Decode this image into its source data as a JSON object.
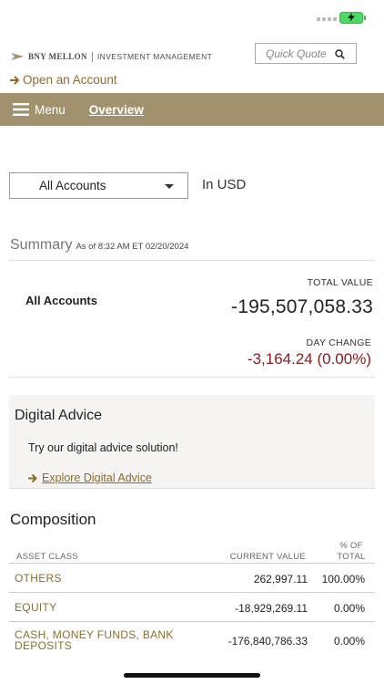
{
  "header": {
    "brand_name": "BNY MELLON",
    "brand_sub": "INVESTMENT MANAGEMENT",
    "quick_quote_placeholder": "Quick Quote",
    "open_account_label": "Open an Account"
  },
  "nav": {
    "menu_label": "Menu",
    "overview_label": "Overview"
  },
  "accounts": {
    "selected": "All Accounts",
    "currency_label": "In USD"
  },
  "summary": {
    "title": "Summary",
    "as_of": "As of 8:32 AM ET 02/20/2024",
    "account_name": "All Accounts",
    "total_value_label": "TOTAL VALUE",
    "total_value": "-195,507,058.33",
    "day_change_label": "DAY CHANGE",
    "day_change": "-3,164.24 (0.00%)"
  },
  "digital_advice": {
    "title": "Digital Advice",
    "text": "Try our digital advice solution!",
    "link_label": "Explore Digital Advice"
  },
  "composition": {
    "title": "Composition",
    "headers": {
      "asset_class": "ASSET CLASS",
      "current_value": "CURRENT VALUE",
      "pct_of_total": "% OF TOTAL"
    },
    "rows": [
      {
        "asset_class": "OTHERS",
        "current_value": "262,997.11",
        "pct": "100.00%"
      },
      {
        "asset_class": "EQUITY",
        "current_value": "-18,929,269.11",
        "pct": "0.00%"
      },
      {
        "asset_class": "CASH, MONEY FUNDS, BANK DEPOSITS",
        "current_value": "-176,840,786.33",
        "pct": "0.00%"
      }
    ]
  },
  "colors": {
    "nav_bar": "#a1926d",
    "link_gold": "#8c6e2a",
    "negative_red": "#8b1a1a"
  }
}
